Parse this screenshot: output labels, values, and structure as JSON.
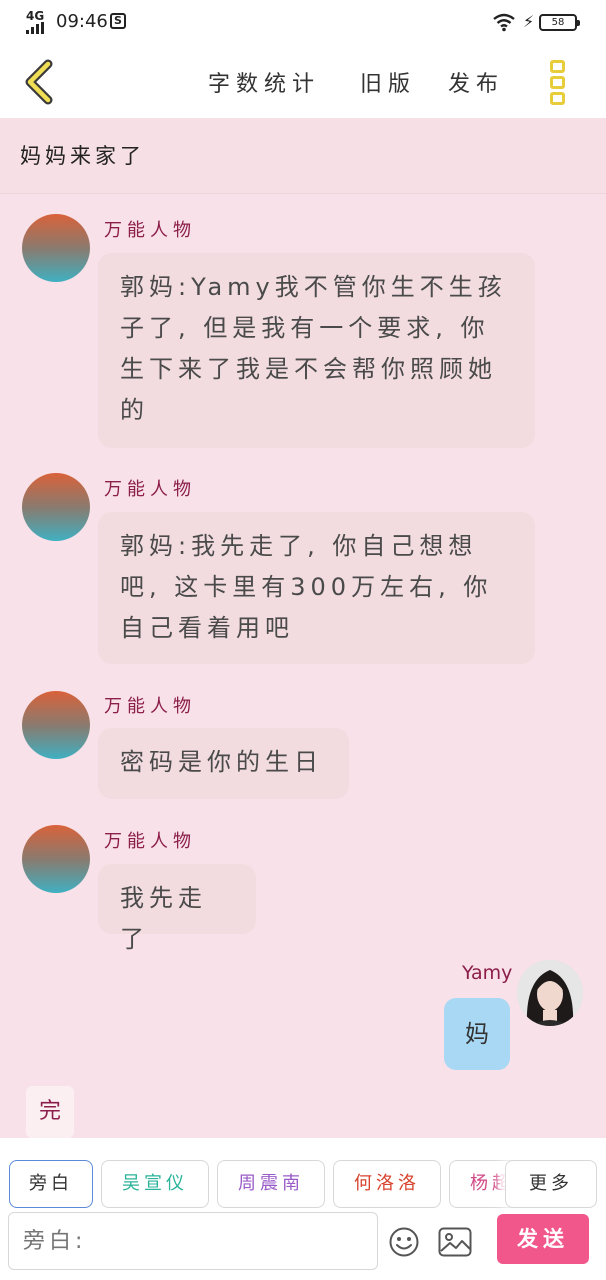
{
  "status_bar": {
    "network": "4G",
    "time": "09:46",
    "app_icon": "S",
    "battery": "58"
  },
  "header": {
    "word_count": "字数统计",
    "old_version": "旧版",
    "publish": "发布"
  },
  "story_title": "妈妈来家了",
  "messages": [
    {
      "speaker": "万能人物",
      "text": "郭妈:Yamy我不管你生不生孩子了, 但是我有一个要求, 你生下来了我是不会帮你照顾她的"
    },
    {
      "speaker": "万能人物",
      "text": "郭妈:我先走了, 你自己想想吧, 这卡里有300万左右, 你自己看着用吧"
    },
    {
      "speaker": "万能人物",
      "text": "密码是你的生日"
    },
    {
      "speaker": "万能人物",
      "text": "我先走了"
    }
  ],
  "user_message": {
    "speaker": "Yamy",
    "text": "妈"
  },
  "end_marker": "完",
  "roles": [
    {
      "label": "旁白",
      "color": "#333333"
    },
    {
      "label": "吴宣仪",
      "color": "#2bb39a"
    },
    {
      "label": "周震南",
      "color": "#9a5cc8"
    },
    {
      "label": "何洛洛",
      "color": "#d8442e"
    },
    {
      "label": "杨超",
      "color": "#d04a86"
    }
  ],
  "more_roles": "更多",
  "input": {
    "placeholder": "旁白:"
  },
  "send_label": "发送",
  "colors": {
    "accent": "#f2578c",
    "page_bg": "#f8e1e8",
    "bubble": "#f2dce0",
    "user_bubble": "#a9d8f4",
    "name": "#8c1e4a"
  }
}
